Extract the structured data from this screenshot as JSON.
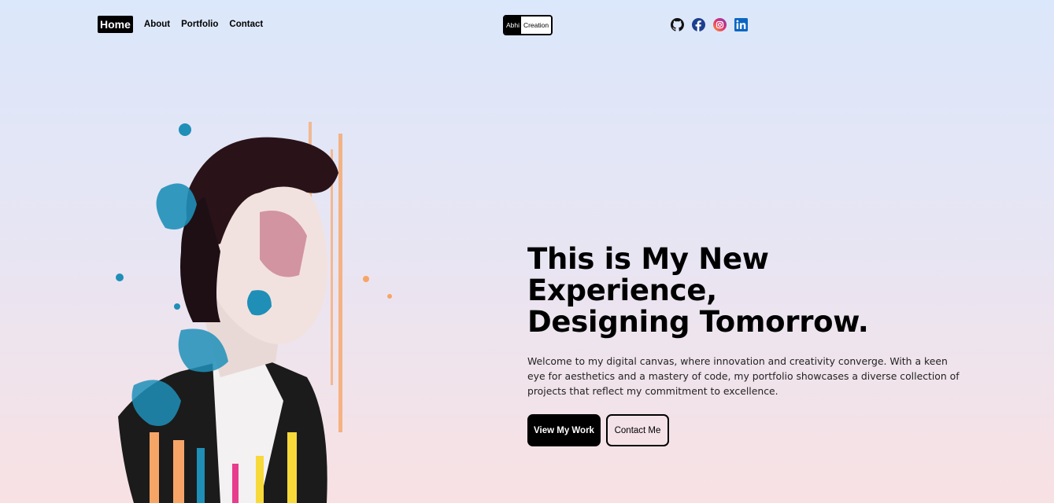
{
  "nav": {
    "links": [
      {
        "label": "Home",
        "active": true
      },
      {
        "label": "About",
        "active": false
      },
      {
        "label": "Portfolio",
        "active": false
      },
      {
        "label": "Contact",
        "active": false
      }
    ]
  },
  "logo": {
    "part1": "Abhi",
    "part2": "Creation"
  },
  "social": [
    "github-icon",
    "facebook-icon",
    "instagram-icon",
    "linkedin-icon"
  ],
  "hero": {
    "title_line1": "This is My New Experience,",
    "title_line2": "Designing Tomorrow.",
    "description": "Welcome to my digital canvas, where innovation and creativity converge. With a keen eye for aesthetics and a mastery of code, my portfolio showcases a diverse collection of projects that reflect my commitment to excellence.",
    "primary_button": "View My Work",
    "secondary_button": "Contact Me"
  },
  "colors": {
    "bg_top": "#dbe7fb",
    "bg_bottom": "#f8e1e3",
    "accent": "#000000"
  }
}
